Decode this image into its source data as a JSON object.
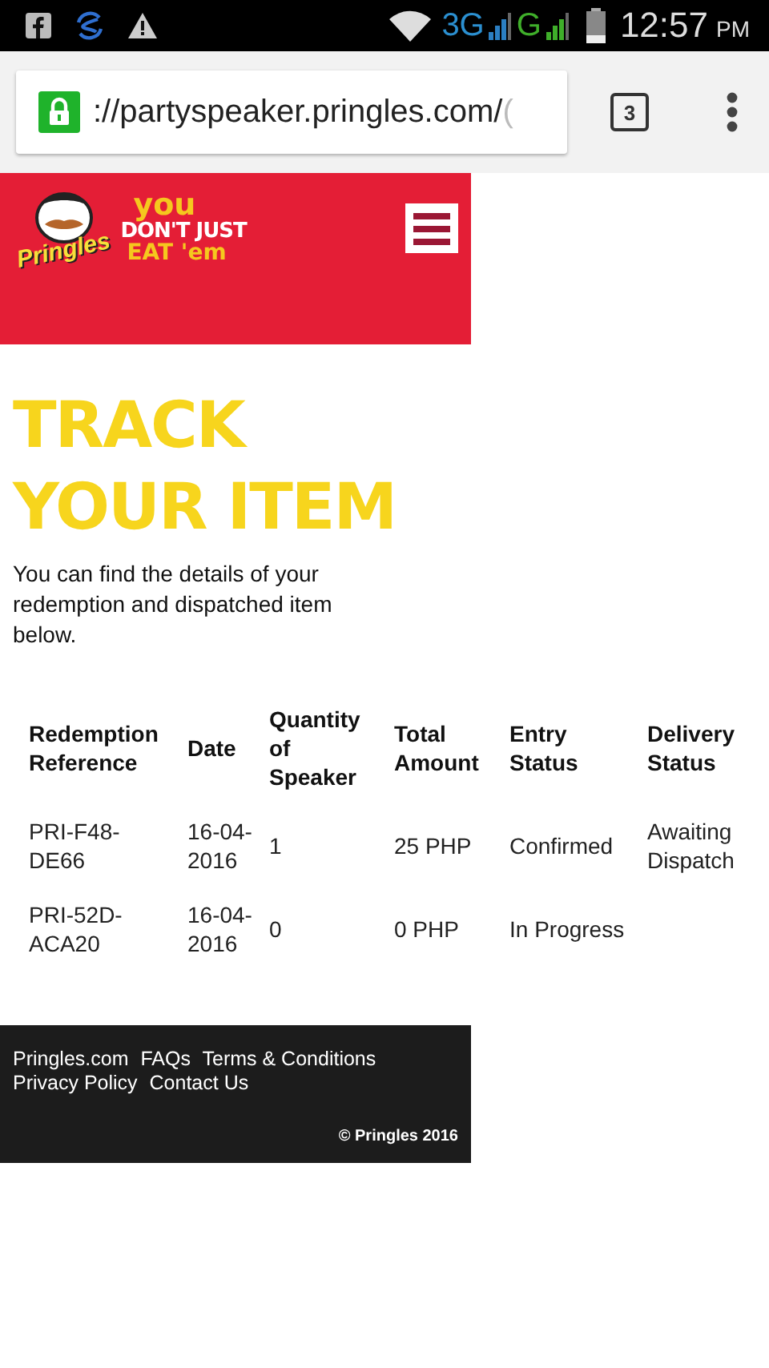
{
  "status_bar": {
    "network_3g": "3G",
    "network_g": "G",
    "time": "12:57",
    "ampm": "PM"
  },
  "browser": {
    "url": "://partyspeaker.pringles.com/",
    "url_cut": "(",
    "tab_count": "3"
  },
  "header": {
    "brand": "Pringles",
    "tagline": [
      "you",
      "DON'T JUST",
      "EAT 'em"
    ]
  },
  "page": {
    "title": [
      "TRACK",
      "YOUR ITEM"
    ],
    "intro": "You can find the details of your redemption and dispatched item below."
  },
  "table": {
    "columns": [
      "Redemption Reference",
      "Date",
      "Quantity of Speaker",
      "Total Amount",
      "Entry Status",
      "Delivery Status"
    ],
    "rows": [
      [
        "PRI-F48-DE66",
        "16-04-2016",
        "1",
        "25 PHP",
        "Confirmed",
        "Awaiting Dispatch"
      ],
      [
        "PRI-52D-ACA20",
        "16-04-2016",
        "0",
        "0 PHP",
        "In Progress",
        ""
      ]
    ]
  },
  "footer": {
    "links": [
      "Pringles.com",
      "FAQs",
      "Terms & Conditions",
      "Privacy Policy",
      "Contact Us"
    ],
    "copyright": "© Pringles 2016"
  }
}
